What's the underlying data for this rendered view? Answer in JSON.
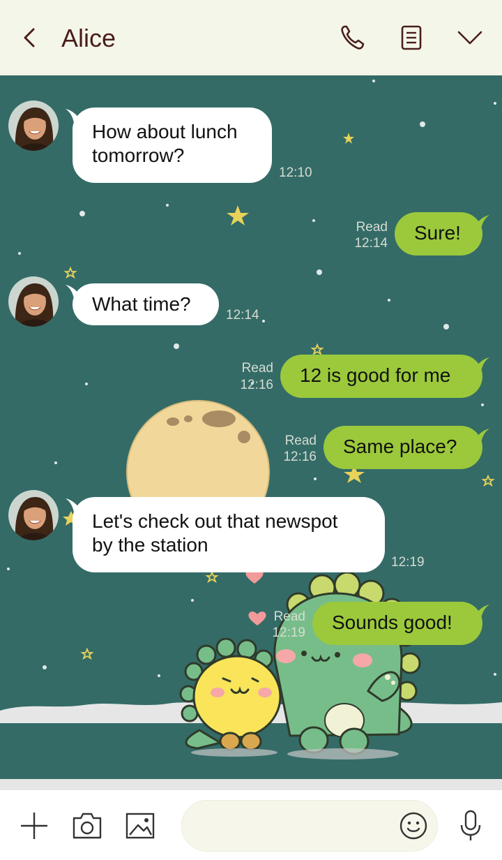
{
  "header": {
    "title": "Alice"
  },
  "icons": {
    "back": "chevron-left-icon",
    "call": "phone-icon",
    "notes": "note-icon",
    "menu": "chevron-down-icon",
    "add": "plus-icon",
    "camera": "camera-icon",
    "gallery": "image-icon",
    "emoji": "smiley-icon",
    "voice": "microphone-icon"
  },
  "colors": {
    "header_bg": "#f5f6ea",
    "chat_bg": "#346b67",
    "sent_bubble": "#9bc93b",
    "received_bubble": "#ffffff",
    "title": "#4a1e1a",
    "meta": "#d6dcd2"
  },
  "messages": [
    {
      "sender": "Alice",
      "direction": "in",
      "lines": [
        "How about lunch",
        "tomorrow?"
      ],
      "time": "12:10"
    },
    {
      "direction": "out",
      "lines": [
        "Sure!"
      ],
      "status": "Read",
      "time": "12:14"
    },
    {
      "sender": "Alice",
      "direction": "in",
      "lines": [
        "What time?"
      ],
      "time": "12:14"
    },
    {
      "direction": "out",
      "lines": [
        "12 is good for me"
      ],
      "status": "Read",
      "time": "12:16"
    },
    {
      "direction": "out",
      "lines": [
        "Same place?"
      ],
      "status": "Read",
      "time": "12:16"
    },
    {
      "sender": "Alice",
      "direction": "in",
      "lines": [
        "Let's check out that newspot",
        "by the station"
      ],
      "time": "12:19"
    },
    {
      "direction": "out",
      "lines": [
        "Sounds good!"
      ],
      "status": "Read",
      "time": "12:19"
    }
  ],
  "input": {
    "placeholder": ""
  }
}
